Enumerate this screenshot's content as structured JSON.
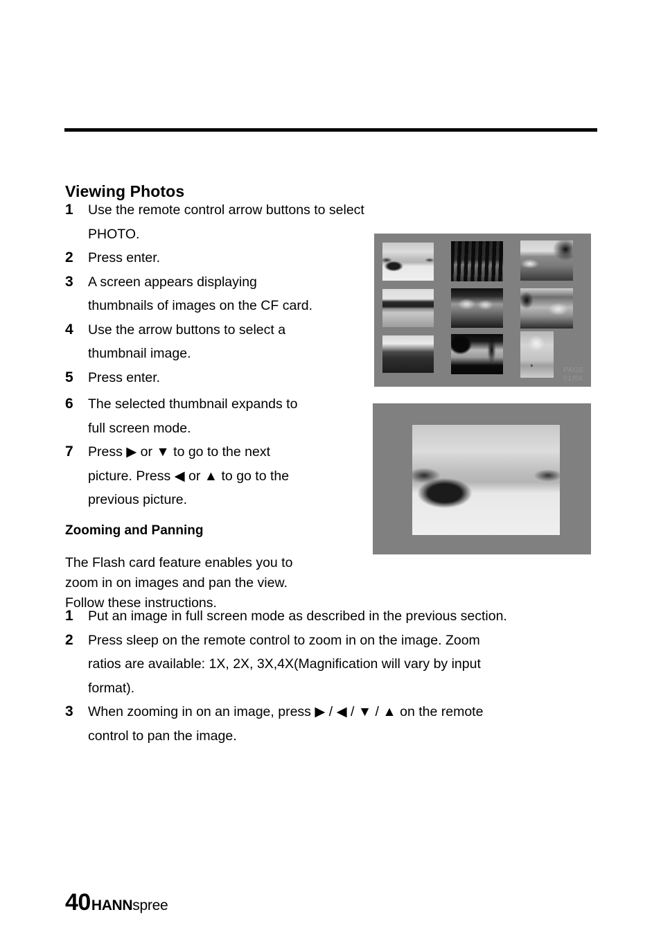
{
  "document": {
    "page_number": "40",
    "brand_bold": "HANN",
    "brand_light": "spree"
  },
  "section": {
    "title": "Viewing Photos",
    "steps": [
      {
        "num": "1",
        "text": "Use the remote control arrow buttons to select PHOTO."
      },
      {
        "num": "2",
        "text": "Press enter."
      },
      {
        "num": "3",
        "text": "A screen appears displaying\nthumbnails of images on the CF card."
      },
      {
        "num": "4",
        "text": "Use the arrow buttons to select a\nthumbnail image."
      },
      {
        "num": "5",
        "text": "Press enter."
      }
    ],
    "steps_continued": [
      {
        "num": "6",
        "text": "The selected thumbnail expands to\nfull screen mode."
      },
      {
        "num": "7",
        "text": "Press ▶ or ▼ to go to the next\npicture. Press ◀ or ▲ to go to the\nprevious picture."
      }
    ]
  },
  "subsection": {
    "title": "Zooming and Panning",
    "intro": "The Flash card feature enables you to\nzoom in on images and pan the view.\nFollow these instructions.",
    "steps": [
      {
        "num": "1",
        "text": "Put an image in full screen mode as described in the previous section."
      },
      {
        "num": "2",
        "text": "Press sleep on the remote control to zoom in on the image. Zoom\nratios are available: 1X, 2X, 3X,4X(Magnification will vary by input\nformat)."
      },
      {
        "num": "3",
        "text": "When zooming in on an image, press ▶ / ◀ / ▼ / ▲ on the remote\ncontrol to pan the image."
      }
    ]
  },
  "figures": {
    "thumbnail_screen": {
      "background_color": "#808080",
      "page_indicator_line1": "PAGE",
      "page_indicator_line2": "01/04",
      "thumbnails": [
        {
          "name": "boat-on-beach",
          "style": "ph-boat-beach"
        },
        {
          "name": "palm-trees-shore",
          "style": "ph-palms-dark"
        },
        {
          "name": "harbor-boats",
          "style": "ph-harbor"
        },
        {
          "name": "lagoon-reflection",
          "style": "ph-lagoon"
        },
        {
          "name": "thatched-huts",
          "style": "ph-huts"
        },
        {
          "name": "village-houses",
          "style": "ph-houses"
        },
        {
          "name": "dark-sea-horizon",
          "style": "ph-sea-dark"
        },
        {
          "name": "tree-silhouette-pier",
          "style": "ph-tree-silh"
        },
        {
          "name": "field-with-clouds",
          "style": "ph-field-cloud"
        }
      ]
    },
    "fullscreen_photo": {
      "background_color": "#808080",
      "photo_name": "boat-on-beach",
      "style": "ph-boat-beach"
    }
  }
}
